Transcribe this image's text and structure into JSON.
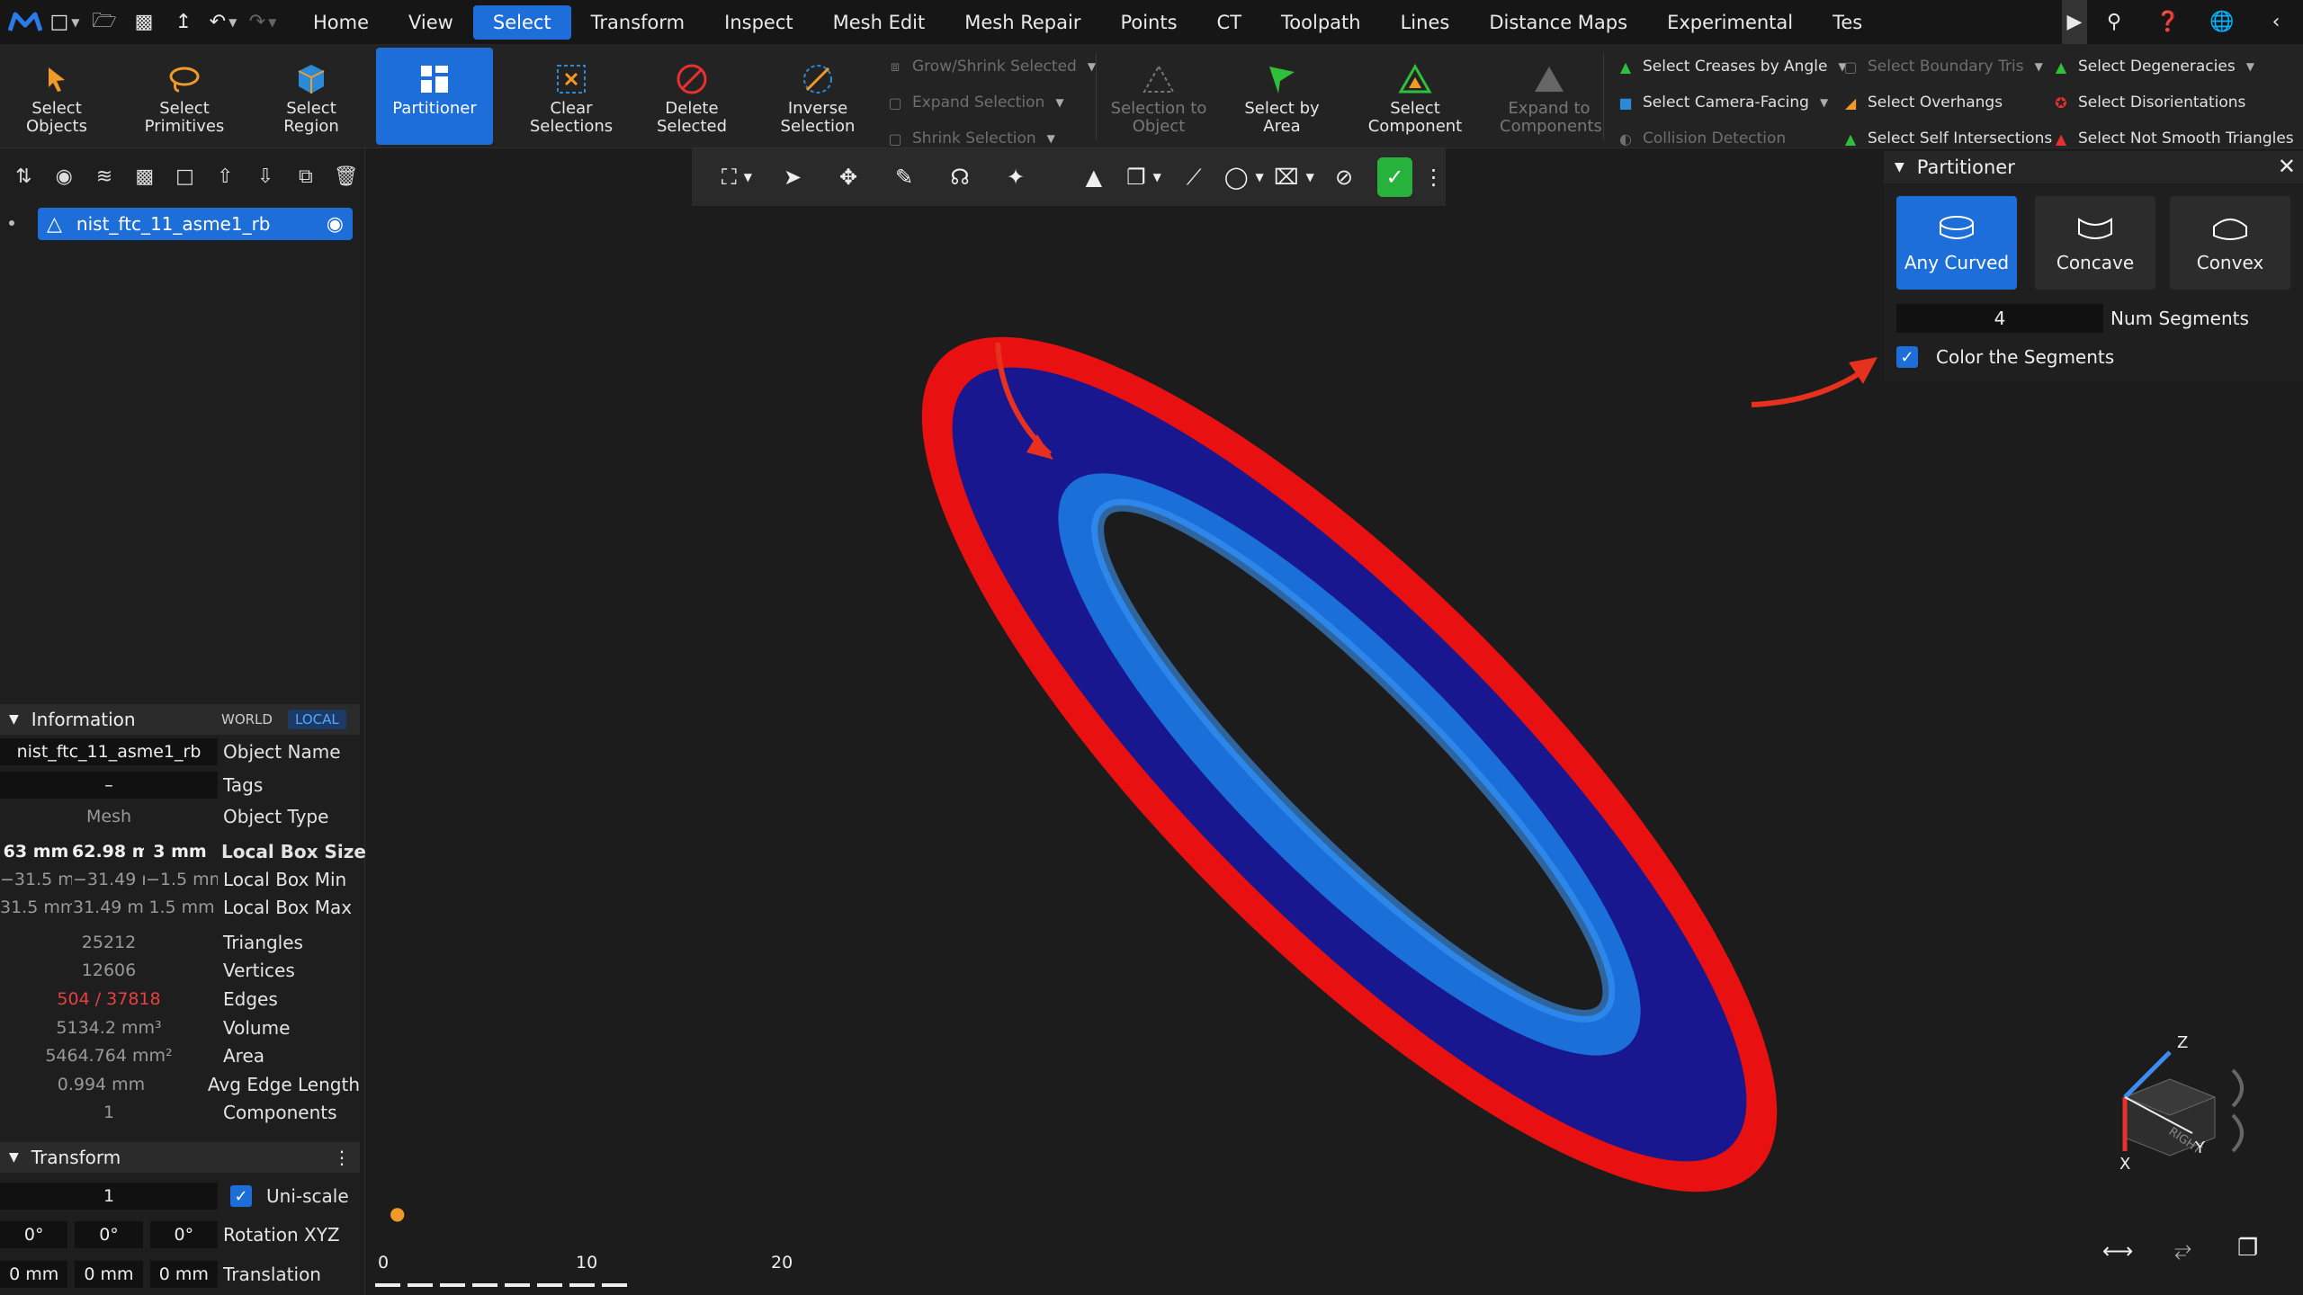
{
  "menubar": {
    "items": [
      "Home",
      "View",
      "Select",
      "Transform",
      "Inspect",
      "Mesh Edit",
      "Mesh Repair",
      "Points",
      "CT",
      "Toolpath",
      "Lines",
      "Distance Maps",
      "Experimental",
      "Tes"
    ],
    "active": "Select"
  },
  "ribbon": {
    "select_objects": "Select Objects",
    "select_primitives": "Select Primitives",
    "select_region": "Select Region",
    "partitioner": "Partitioner",
    "clear_selections": "Clear Selections",
    "delete_selected": "Delete Selected",
    "inverse_selection": "Inverse Selection",
    "grow_shrink": "Grow/Shrink Selected",
    "expand_selection": "Expand Selection",
    "shrink_selection": "Shrink Selection",
    "selection_to_object": "Selection to Object",
    "select_by_area": "Select by Area",
    "select_component": "Select Component",
    "expand_to_components": "Expand to Components",
    "select_creases": "Select Creases by Angle",
    "select_camera_facing": "Select Camera-Facing",
    "collision_detection": "Collision Detection",
    "select_boundary_tris": "Select Boundary Tris",
    "select_overhangs": "Select Overhangs",
    "select_self_intersections": "Select Self Intersections",
    "select_degeneracies": "Select Degeneracies",
    "select_disorientations": "Select Disorientations",
    "select_not_smooth": "Select Not Smooth Triangles"
  },
  "scene": {
    "object_name": "nist_ftc_11_asme1_rb"
  },
  "information": {
    "title": "Information",
    "world": "WORLD",
    "local": "LOCAL",
    "rows": [
      {
        "value": "nist_ftc_11_asme1_rb",
        "label": "Object Name"
      },
      {
        "value": "–",
        "label": "Tags"
      },
      {
        "value": "Mesh",
        "label": "Object Type"
      }
    ],
    "box_size": [
      "63 mm",
      "62.98 m",
      "3 mm"
    ],
    "box_size_label": "Local Box Size",
    "box_min": [
      "−31.5 mi",
      "−31.49 n",
      "−1.5 mm"
    ],
    "box_min_label": "Local Box Min",
    "box_max": [
      "31.5 mm",
      "31.49 mi",
      "1.5 mm"
    ],
    "box_max_label": "Local Box Max",
    "stats": [
      {
        "value": "25212",
        "label": "Triangles"
      },
      {
        "value": "12606",
        "label": "Vertices"
      },
      {
        "value": "504 / 37818",
        "label": "Edges"
      },
      {
        "value": "5134.2 mm³",
        "label": "Volume"
      },
      {
        "value": "5464.764 mm²",
        "label": "Area"
      },
      {
        "value": "0.994 mm",
        "label": "Avg Edge Length"
      },
      {
        "value": "1",
        "label": "Components"
      }
    ]
  },
  "transform": {
    "title": "Transform",
    "scale": "1",
    "uniscale": "Uni-scale",
    "rotation": [
      "0°",
      "0°",
      "0°"
    ],
    "rotation_label": "Rotation XYZ",
    "translation": [
      "0 mm",
      "0 mm",
      "0 mm"
    ],
    "translation_label": "Translation"
  },
  "partitioner": {
    "title": "Partitioner",
    "modes": [
      "Any Curved",
      "Concave",
      "Convex"
    ],
    "active_mode": "Any Curved",
    "num_segments": "4",
    "num_segments_label": "Num Segments",
    "color_segments": "Color the Segments"
  },
  "scale_bar": {
    "labels": [
      "0",
      "10",
      "20"
    ]
  },
  "viewcube": {
    "face": "RIGHT",
    "axes": [
      "Z",
      "X",
      "Y"
    ]
  },
  "colors": {
    "accent": "#1d6ed8",
    "outer_ring": "#f01010",
    "inner_disc": "#18178f",
    "inner_ring": "#1a6fd8",
    "arrow": "#e8301e"
  }
}
